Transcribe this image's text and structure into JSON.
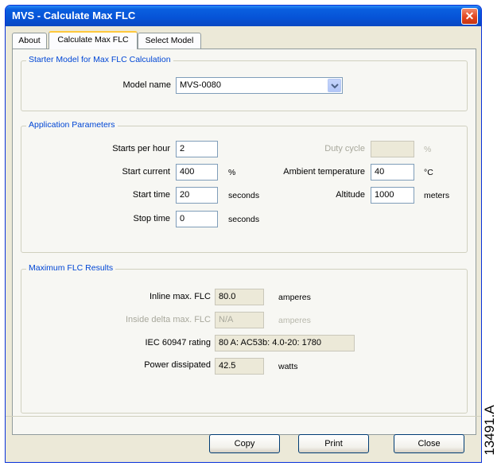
{
  "window": {
    "title": "MVS - Calculate Max FLC",
    "close_glyph": "✕"
  },
  "tabs": [
    {
      "label": "About"
    },
    {
      "label": "Calculate Max FLC"
    },
    {
      "label": "Select Model"
    }
  ],
  "starter_model": {
    "title": "Starter Model for Max FLC Calculation",
    "model_name_label": "Model name",
    "model_name_value": "MVS-0080"
  },
  "application": {
    "title": "Application Parameters",
    "starts_per_hour": {
      "label": "Starts per hour",
      "value": "2"
    },
    "start_current": {
      "label": "Start current",
      "value": "400",
      "unit": "%"
    },
    "start_time": {
      "label": "Start time",
      "value": "20",
      "unit": "seconds"
    },
    "stop_time": {
      "label": "Stop time",
      "value": "0",
      "unit": "seconds"
    },
    "duty_cycle": {
      "label": "Duty cycle",
      "value": "",
      "unit": "%"
    },
    "ambient_temperature": {
      "label": "Ambient temperature",
      "value": "40",
      "unit": "°C"
    },
    "altitude": {
      "label": "Altitude",
      "value": "1000",
      "unit": "meters"
    }
  },
  "results": {
    "title": "Maximum FLC Results",
    "inline_max": {
      "label": "Inline max. FLC",
      "value": "80.0",
      "unit": "amperes"
    },
    "inside_delta_max": {
      "label": "Inside delta max. FLC",
      "value": "N/A",
      "unit": "amperes"
    },
    "iec_rating": {
      "label": "IEC 60947 rating",
      "value": "80 A: AC53b: 4.0-20: 1780"
    },
    "power_dissipated": {
      "label": "Power dissipated",
      "value": "42.5",
      "unit": "watts"
    }
  },
  "buttons": {
    "copy": "Copy",
    "print": "Print",
    "close": "Close"
  },
  "figure_id": "13491.A"
}
